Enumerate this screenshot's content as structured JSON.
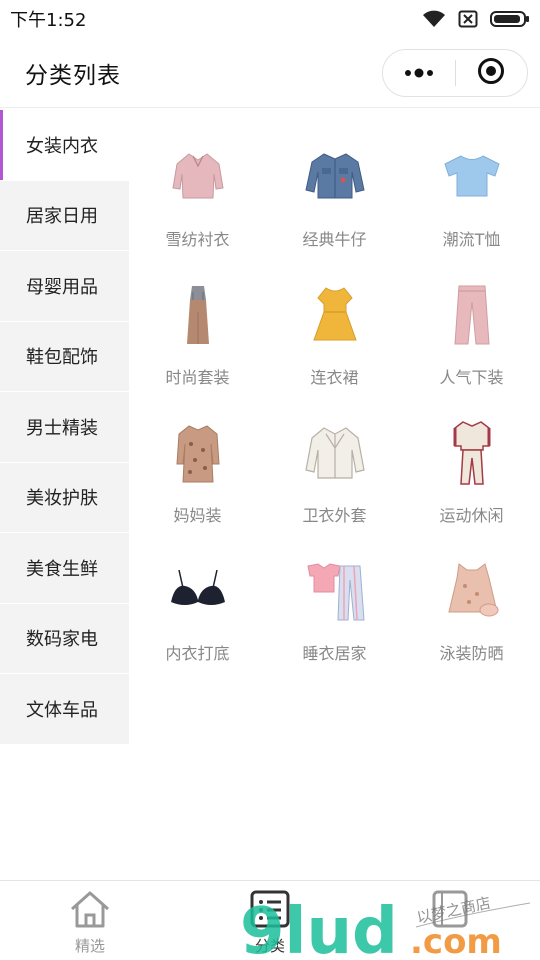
{
  "status": {
    "time": "下午1:52"
  },
  "nav": {
    "title": "分类列表"
  },
  "sidebar": {
    "items": [
      {
        "label": "女装内衣"
      },
      {
        "label": "居家日用"
      },
      {
        "label": "母婴用品"
      },
      {
        "label": "鞋包配饰"
      },
      {
        "label": "男士精装"
      },
      {
        "label": "美妆护肤"
      },
      {
        "label": "美食生鲜"
      },
      {
        "label": "数码家电"
      },
      {
        "label": "文体车品"
      }
    ]
  },
  "grid": {
    "items": [
      {
        "label": "雪纺衬衣"
      },
      {
        "label": "经典牛仔"
      },
      {
        "label": "潮流T恤"
      },
      {
        "label": "时尚套装"
      },
      {
        "label": "连衣裙"
      },
      {
        "label": "人气下装"
      },
      {
        "label": "妈妈装"
      },
      {
        "label": "卫衣外套"
      },
      {
        "label": "运动休闲"
      },
      {
        "label": "内衣打底"
      },
      {
        "label": "睡衣居家"
      },
      {
        "label": "泳装防晒"
      }
    ]
  },
  "tabbar": {
    "tabs": [
      {
        "label": "精选",
        "icon": "home-icon"
      },
      {
        "label": "分类",
        "icon": "list-icon"
      },
      {
        "label": "",
        "icon": "notebook-icon"
      }
    ]
  },
  "watermark": {
    "text": "9lud.com",
    "handwritten": "以梦之商店"
  },
  "colors": {
    "accent": "#b157d6",
    "sidebar_bg": "#f3f3f3",
    "label_gray": "#888888"
  }
}
